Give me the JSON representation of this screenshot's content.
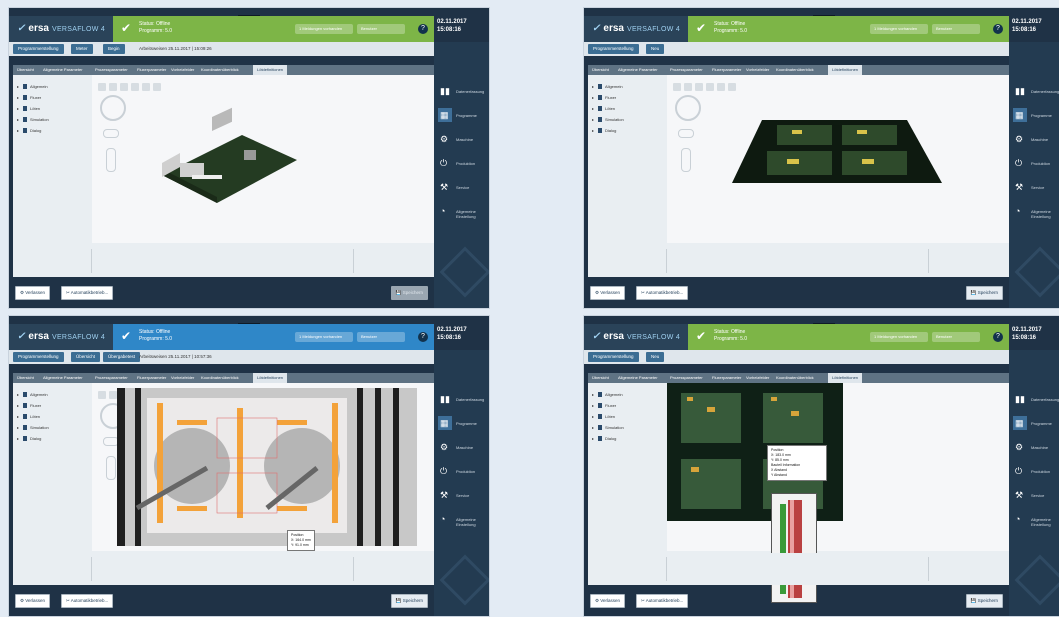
{
  "header": {
    "logo": "ersa",
    "product": "VERSAFLOW 4",
    "status_text": "Status: Offline",
    "program_text": "Programm: 5.0",
    "warnings": "1 Meldungen vorhanden",
    "user": "Benutzer",
    "help": "Hilfe"
  },
  "screens": [
    {
      "date": "02.11.2017",
      "time": "15:08:16",
      "header_style": "green",
      "breadcrumb": [
        "Programmerstellung",
        "Meter",
        "Begin"
      ],
      "crumb_info": "Arbeitsweisen 25.11.2017 | 15:09:26",
      "scene": "iso",
      "save_disabled": true
    },
    {
      "date": "02.11.2017",
      "time": "15:08:16",
      "header_style": "green",
      "breadcrumb": [
        "Programmerstellung",
        "Neu"
      ],
      "crumb_info": "",
      "scene": "flat",
      "save_disabled": false
    },
    {
      "date": "02.11.2017",
      "time": "15:08:16",
      "header_style": "blue",
      "breadcrumb": [
        "Programmerstellung",
        "Übersicht",
        "Übergabetest"
      ],
      "crumb_info": "Arbeitsweisen 25.11.2017 | 10:57:36",
      "scene": "top",
      "save_disabled": false
    },
    {
      "date": "02.11.2017",
      "time": "15:08:16",
      "header_style": "green",
      "breadcrumb": [
        "Programmerstellung",
        "Neu"
      ],
      "crumb_info": "",
      "scene": "photo",
      "save_disabled": false
    }
  ],
  "tabs": [
    "Übersicht",
    "Allgemeine Parameter",
    "Prozessparameter",
    "Fluxerparameter",
    "Vorheizfelder",
    "Koordinatenüberblick",
    "Lötdefinitionen"
  ],
  "active_tab": "Lötdefinitionen",
  "tree": [
    "Allgemein",
    "Fluxer",
    "Löten",
    "Simulation",
    "Dialog"
  ],
  "bottom": {
    "left_btn": "Verlassen",
    "mid_btn": "Automatikbetrieb...",
    "save": "Speichern"
  },
  "sidebar": [
    {
      "label": "Datenerfassung",
      "icon": "chart-icon"
    },
    {
      "label": "Programme",
      "icon": "program-icon"
    },
    {
      "label": "Maschine",
      "icon": "machine-icon"
    },
    {
      "label": "Produktion",
      "icon": "production-icon"
    },
    {
      "label": "Service",
      "icon": "service-icon"
    },
    {
      "label": "Allgemeine Einstellung",
      "icon": "settings-icon"
    }
  ],
  "tooltips": {
    "screen3": [
      "Position",
      "X: 164.0 mm",
      "Y: 91.0 mm"
    ],
    "screen4": [
      "Position",
      "X: 183.0 mm",
      "Y: 85.0 mm",
      "Bauteil Information",
      "X Abstand",
      "Y Abstand"
    ]
  },
  "colors": {
    "header_dark": "#2a4359",
    "status_green": "#7db547",
    "status_blue": "#2f87c8",
    "sidebar": "#233b51",
    "active_side": "#3e6f99"
  }
}
